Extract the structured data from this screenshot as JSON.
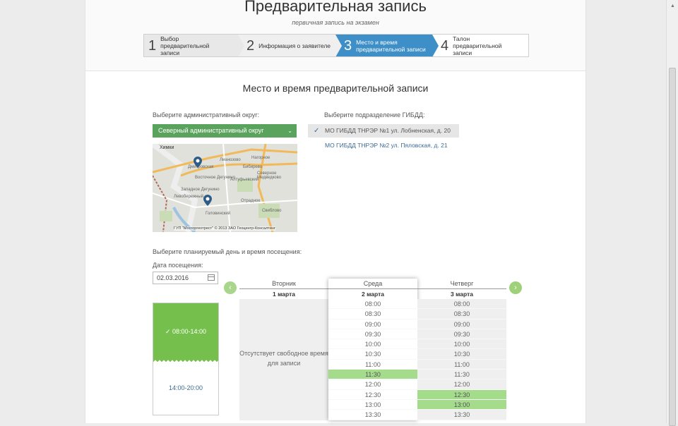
{
  "header": {
    "title": "Предварительная запись",
    "subtitle": "первичная запись на экзамен"
  },
  "steps": [
    {
      "num": "1",
      "label": "Выбор предварительной записи"
    },
    {
      "num": "2",
      "label": "Информация о заявителе"
    },
    {
      "num": "3",
      "label": "Место и время предварительной записи"
    },
    {
      "num": "4",
      "label": "Талон предварительной записи"
    }
  ],
  "section": {
    "title": "Место и время предварительной записи"
  },
  "district": {
    "label": "Выберите административный округ:",
    "selected": "Северный административный округ"
  },
  "map": {
    "labels": [
      "Химки",
      "Нагорное",
      "Дмитровская",
      "Бибирево",
      "Северное Медведково",
      "Лианозово",
      "Восточное Дегунино",
      "Алтуфьевский",
      "Западное Дегунино",
      "Отрадное",
      "Головинский",
      "Свиблово",
      "Левобережный"
    ],
    "copyright": "ГУП \"Мосгоргеотрест\" © 2013 ЗАО Геоцентр-Консалтинг"
  },
  "department": {
    "label": "Выберите подразделение ГИБДД:",
    "items": [
      "МО ГИБДД ТНРЭР №1 ул. Лобненская, д. 20",
      "МО ГИБДД ТНРЭР №2 ул. Пяловская, д. 21"
    ]
  },
  "schedule": {
    "label": "Выберите планируемый день и время посещения:",
    "date_label": "Дата посещения:",
    "date_value": "02.03.2016",
    "periods": [
      "08:00-14:00",
      "14:00-20:00"
    ],
    "days": [
      {
        "name": "Вторник",
        "date": "1 марта",
        "empty": "Отсутствует свободное время для записи"
      },
      {
        "name": "Среда",
        "date": "2 марта",
        "slots": [
          "08:00",
          "08:30",
          "09:00",
          "09:30",
          "10:00",
          "10:30",
          "11:00",
          "11:30",
          "12:00",
          "12:30",
          "13:00",
          "13:30"
        ],
        "free": [
          "11:30"
        ]
      },
      {
        "name": "Четверг",
        "date": "3 марта",
        "slots": [
          "08:00",
          "08:30",
          "09:00",
          "09:30",
          "10:00",
          "10:30",
          "11:00",
          "11:30",
          "12:00",
          "12:30",
          "13:00",
          "13:30"
        ],
        "free": [
          "12:30",
          "13:00"
        ]
      }
    ]
  },
  "colors": {
    "accent": "#3e8fc8",
    "selected_green": "#5aa35c",
    "free_slot": "#a4dc8b",
    "period_active": "#75c04c"
  }
}
